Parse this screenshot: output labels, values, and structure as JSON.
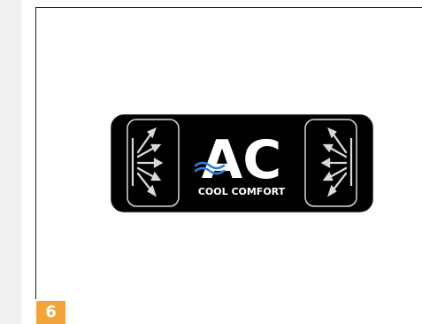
{
  "logo": {
    "main_text": "AC",
    "tagline": "COOL COMFORT",
    "background_color": "#000000",
    "text_color": "#ffffff",
    "wave_color": "#2d7ed8",
    "icons": [
      "air-vent-icon",
      "air-vent-icon"
    ]
  },
  "badge": {
    "label": "6",
    "color": "#f2a43a"
  }
}
